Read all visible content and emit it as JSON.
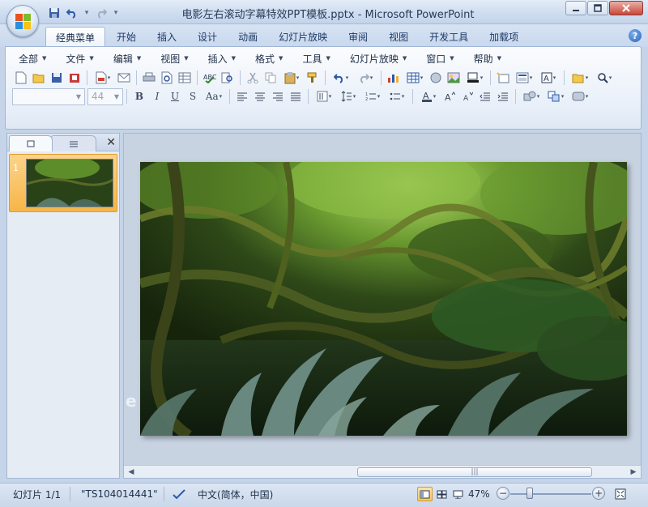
{
  "window": {
    "title": "电影左右滚动字幕特效PPT模板.pptx - Microsoft PowerPoint"
  },
  "tabs": [
    {
      "label": "经典菜单",
      "active": true
    },
    {
      "label": "开始"
    },
    {
      "label": "插入"
    },
    {
      "label": "设计"
    },
    {
      "label": "动画"
    },
    {
      "label": "幻灯片放映"
    },
    {
      "label": "审阅"
    },
    {
      "label": "视图"
    },
    {
      "label": "开发工具"
    },
    {
      "label": "加载项"
    }
  ],
  "menubar": [
    {
      "label": "全部"
    },
    {
      "label": "文件"
    },
    {
      "label": "编辑"
    },
    {
      "label": "视图"
    },
    {
      "label": "插入"
    },
    {
      "label": "格式"
    },
    {
      "label": "工具"
    },
    {
      "label": "幻灯片放映"
    },
    {
      "label": "窗口"
    },
    {
      "label": "帮助"
    }
  ],
  "toolbar": {
    "font_size": "44",
    "font_name": ""
  },
  "slide_pane": {
    "slide_number": "1",
    "slide_ghost_text": "e"
  },
  "statusbar": {
    "slide_info": "幻灯片 1/1",
    "theme": "\"TS104014441\"",
    "language": "中文(简体，中国)",
    "zoom": "47%"
  },
  "colors": {
    "accent_orange": "#f7b548",
    "ribbon_blue": "#c5d4e8"
  }
}
